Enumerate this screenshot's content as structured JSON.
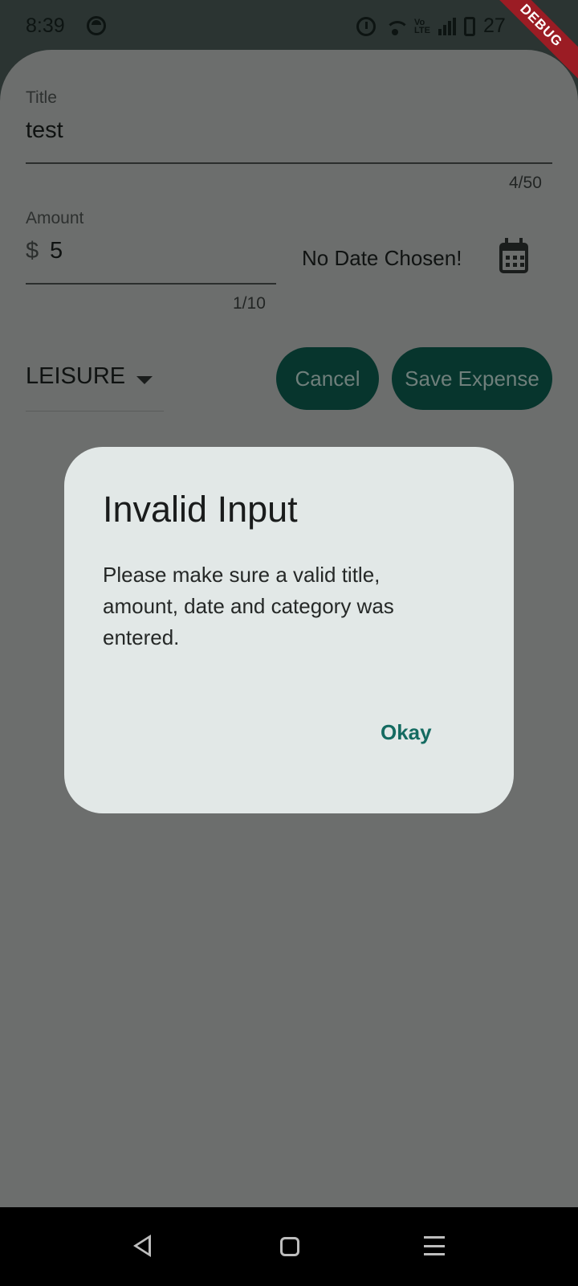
{
  "status_bar": {
    "time": "8:39",
    "volte": "Vo LTE",
    "battery_text": "27"
  },
  "debug_banner": "DEBUG",
  "form": {
    "title_label": "Title",
    "title_value": "test",
    "title_counter": "4/50",
    "amount_label": "Amount",
    "amount_prefix": "$",
    "amount_value": "5",
    "amount_counter": "1/10",
    "date_text": "No Date Chosen!",
    "category_value": "LEISURE",
    "cancel_label": "Cancel",
    "save_label": "Save Expense"
  },
  "dialog": {
    "title": "Invalid Input",
    "message": "Please make sure a valid title, amount, date and category was entered.",
    "action_label": "Okay"
  },
  "icons": {
    "calendar": "calendar-icon",
    "dropdown": "dropdown-arrow-icon",
    "back": "nav-back-icon",
    "home": "nav-home-icon",
    "recents": "nav-recents-icon"
  },
  "colors": {
    "primary_dark": "#07352d",
    "dialog_bg": "#e2e8e7",
    "action_text": "#146b61",
    "scrim": "#6c6e6d",
    "debug_banner": "#9b1c24"
  }
}
